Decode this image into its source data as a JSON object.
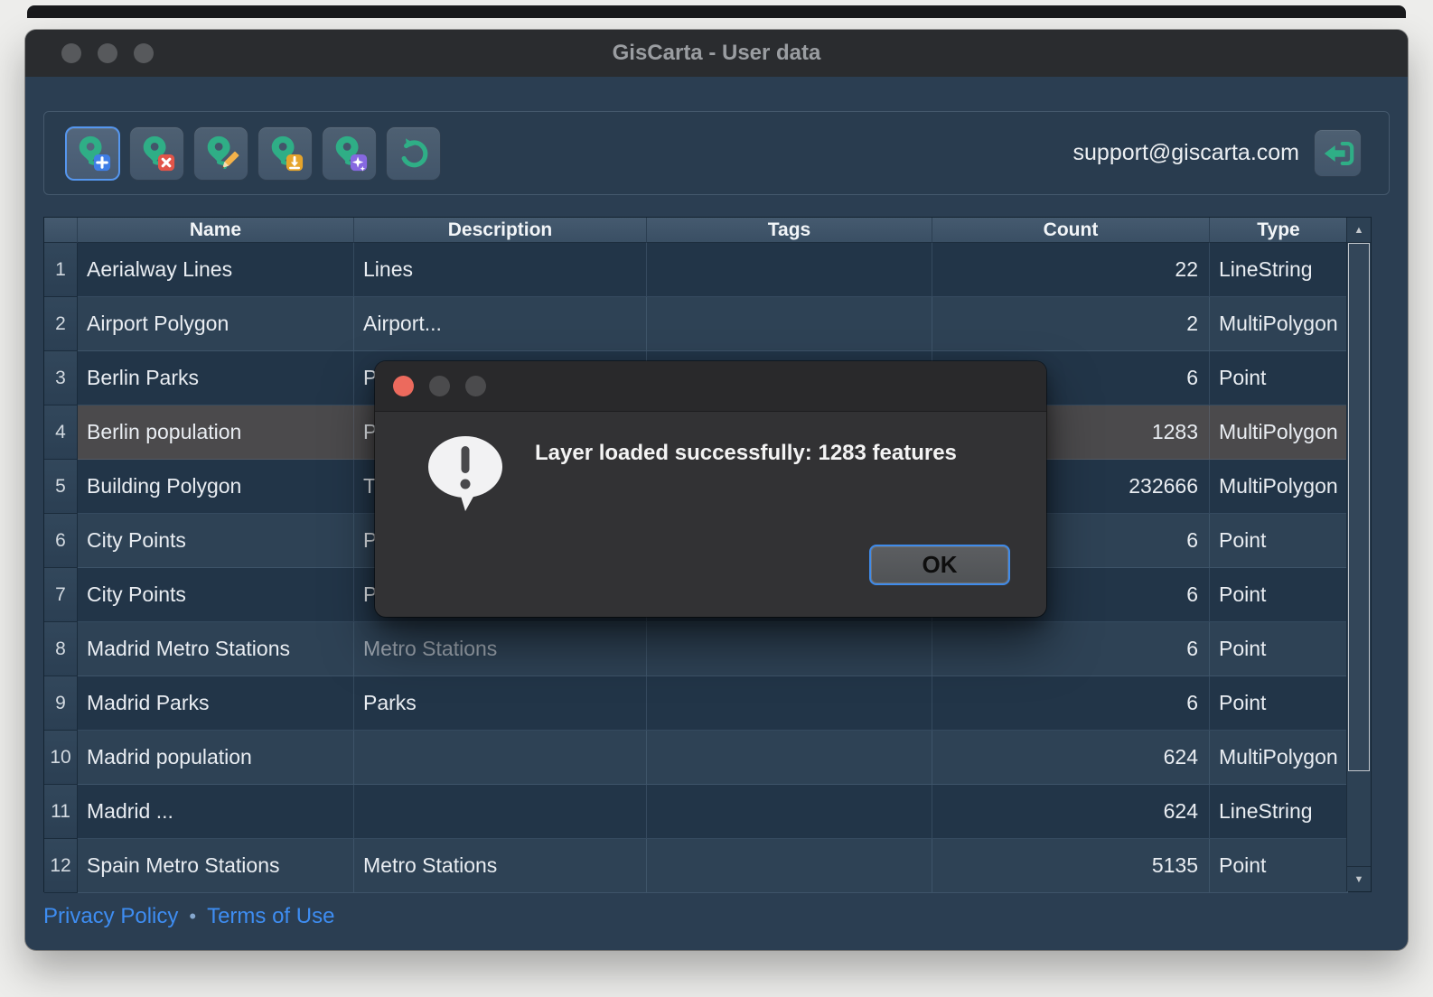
{
  "window": {
    "title": "GisCarta - User data"
  },
  "toolbar": {
    "buttons": [
      {
        "id": "add-layer",
        "icon": "pin-plus-icon",
        "selected": true,
        "badge_color": "#3f7ee6"
      },
      {
        "id": "delete-layer",
        "icon": "pin-delete-icon",
        "selected": false,
        "badge_color": "#e25549"
      },
      {
        "id": "edit-layer",
        "icon": "pin-edit-icon",
        "selected": false,
        "badge_color": "#f4b24a"
      },
      {
        "id": "download-layer",
        "icon": "pin-download-icon",
        "selected": false,
        "badge_color": "#e5a42b"
      },
      {
        "id": "magic-layer",
        "icon": "pin-sparkle-icon",
        "selected": false,
        "badge_color": "#8668e0"
      },
      {
        "id": "refresh",
        "icon": "refresh-icon",
        "selected": false,
        "badge_color": null
      }
    ],
    "email": "support@giscarta.com",
    "logout_icon": "logout-icon"
  },
  "table": {
    "columns": [
      "Name",
      "Description",
      "Tags",
      "Count",
      "Type"
    ],
    "rows": [
      {
        "num": "1",
        "name": "Aerialway Lines",
        "description": "Lines",
        "tags": "",
        "count": "22",
        "type": "LineString",
        "selected": false
      },
      {
        "num": "2",
        "name": "Airport Polygon",
        "description": "Airport...",
        "tags": "",
        "count": "2",
        "type": "MultiPolygon",
        "selected": false
      },
      {
        "num": "3",
        "name": "Berlin Parks",
        "description": "P",
        "tags": "",
        "count": "6",
        "type": "Point",
        "selected": false
      },
      {
        "num": "4",
        "name": "Berlin population",
        "description": "P",
        "tags": "",
        "count": "1283",
        "type": "MultiPolygon",
        "selected": true
      },
      {
        "num": "5",
        "name": "Building Polygon",
        "description": "T",
        "tags": "",
        "count": "232666",
        "type": "MultiPolygon",
        "selected": false
      },
      {
        "num": "6",
        "name": "City Points",
        "description": "P",
        "tags": "",
        "count": "6",
        "type": "Point",
        "selected": false
      },
      {
        "num": "7",
        "name": "City Points",
        "description": "P",
        "tags": "",
        "count": "6",
        "type": "Point",
        "selected": false
      },
      {
        "num": "8",
        "name": "Madrid Metro Stations",
        "description": "Metro Stations",
        "tags": "",
        "count": "6",
        "type": "Point",
        "selected": false,
        "dimmed_description": true
      },
      {
        "num": "9",
        "name": "Madrid Parks",
        "description": "Parks",
        "tags": "",
        "count": "6",
        "type": "Point",
        "selected": false
      },
      {
        "num": "10",
        "name": "Madrid population",
        "description": "",
        "tags": "",
        "count": "624",
        "type": "MultiPolygon",
        "selected": false
      },
      {
        "num": "11",
        "name": "Madrid ...",
        "description": "",
        "tags": "",
        "count": "624",
        "type": "LineString",
        "selected": false
      },
      {
        "num": "12",
        "name": "Spain Metro Stations",
        "description": "Metro Stations",
        "tags": "",
        "count": "5135",
        "type": "Point",
        "selected": false
      }
    ]
  },
  "dialog": {
    "message": "Layer loaded successfully: 1283 features",
    "ok_label": "OK",
    "alert_icon": "exclamation-bubble-icon"
  },
  "footer": {
    "privacy": "Privacy Policy",
    "separator": "•",
    "terms": "Terms of Use"
  },
  "colors": {
    "accent_teal": "#2fae86",
    "focus_ring_blue": "#5596ee",
    "link_blue": "#3e8df2",
    "selected_row": "#4b4a4c",
    "row_odd": "#223548",
    "row_even": "#2e4255",
    "header_bg": "#3f546a",
    "window_bg": "#2b3e52",
    "dialog_bg": "#323234",
    "badge_add": "#3f7ee6",
    "badge_delete": "#e25549",
    "badge_download": "#e5a42b",
    "badge_sparkle": "#8668e0",
    "dialog_close_red": "#ec6a5d"
  }
}
